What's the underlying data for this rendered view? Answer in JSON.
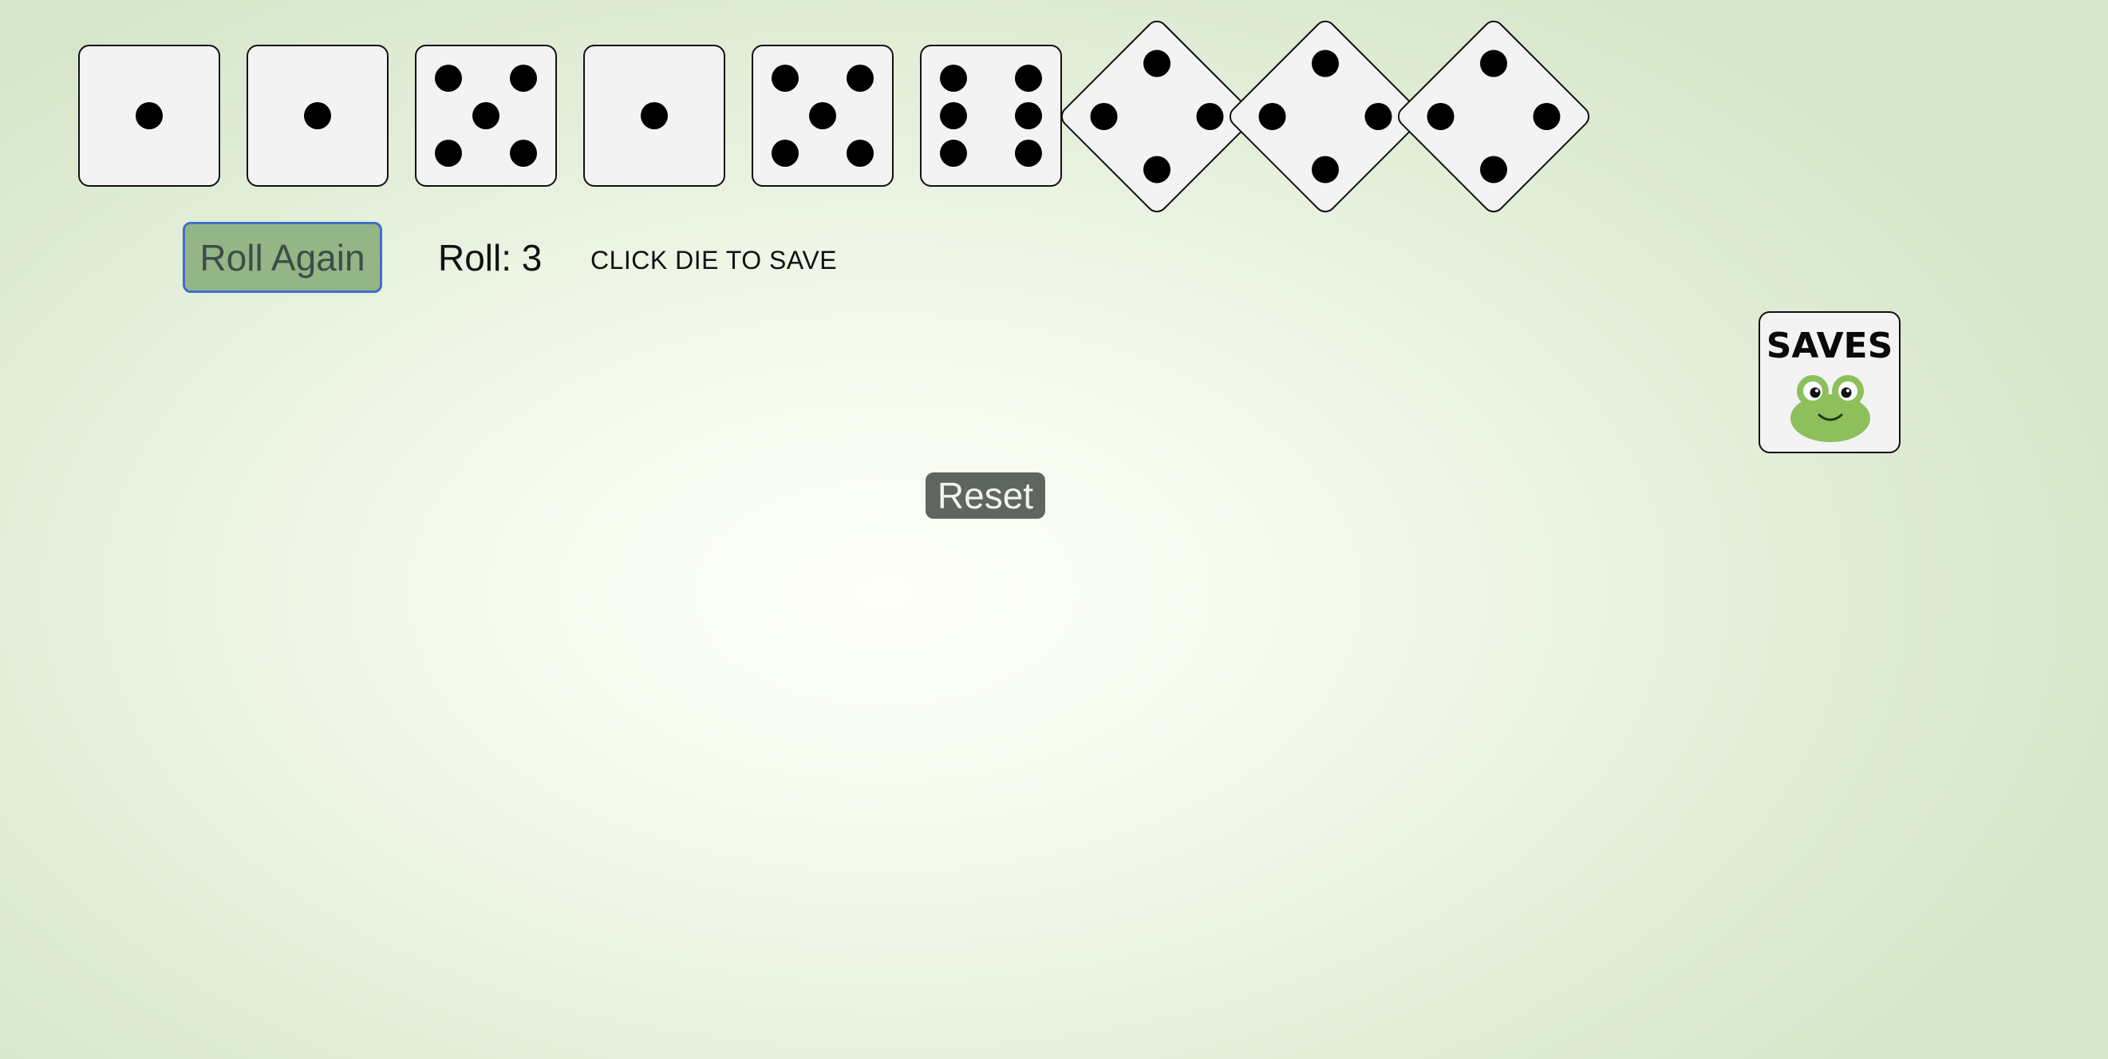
{
  "dice": [
    {
      "value": 1,
      "saved": false,
      "orientation": "upright"
    },
    {
      "value": 1,
      "saved": false,
      "orientation": "upright"
    },
    {
      "value": 5,
      "saved": false,
      "orientation": "upright"
    },
    {
      "value": 1,
      "saved": false,
      "orientation": "upright"
    },
    {
      "value": 5,
      "saved": false,
      "orientation": "upright"
    },
    {
      "value": 6,
      "saved": false,
      "orientation": "upright"
    },
    {
      "value": 4,
      "saved": false,
      "orientation": "tilted"
    },
    {
      "value": 4,
      "saved": false,
      "orientation": "tilted"
    },
    {
      "value": 4,
      "saved": false,
      "orientation": "tilted"
    }
  ],
  "controls": {
    "roll_again_label": "Roll Again",
    "roll_counter": "Roll: 3",
    "hint": "CLICK DIE TO SAVE",
    "reset_label": "Reset"
  },
  "saves": {
    "label": "SAVES",
    "icon": "frog-icon"
  },
  "colors": {
    "roll_button": "#94b585",
    "roll_button_border": "#3d6fc9",
    "reset_button": "#5e665f",
    "die_face": "#f3f3f3",
    "frog": "#8dbf5b"
  }
}
